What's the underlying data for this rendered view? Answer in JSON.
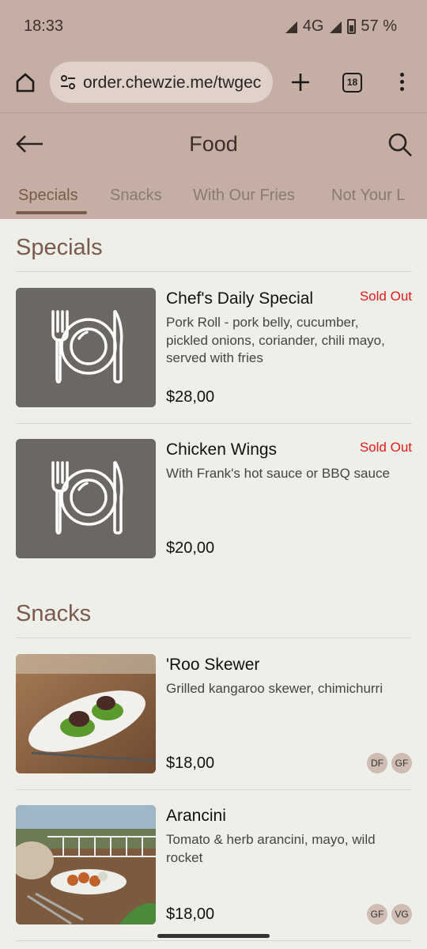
{
  "status": {
    "time": "18:33",
    "network": "4G",
    "battery": "57 %"
  },
  "browser": {
    "url": "order.chewzie.me/twgec",
    "tab_count": "18"
  },
  "appbar": {
    "title": "Food"
  },
  "categories": [
    {
      "label": "Specials"
    },
    {
      "label": "Snacks"
    },
    {
      "label": "With Our Fries"
    },
    {
      "label": "Not Your L"
    }
  ],
  "sections": [
    {
      "title": "Specials",
      "items": [
        {
          "name": "Chef's Daily Special",
          "status": "Sold Out",
          "description": "Pork Roll - pork belly, cucumber, pickled onions, coriander, chili mayo, served with fries",
          "price": "$28,00",
          "image": "placeholder-plate-icon"
        },
        {
          "name": "Chicken Wings",
          "status": "Sold Out",
          "description": "With Frank's hot sauce or BBQ sauce",
          "price": "$20,00",
          "image": "placeholder-plate-icon"
        }
      ]
    },
    {
      "title": "Snacks",
      "items": [
        {
          "name": "'Roo Skewer",
          "description": "Grilled kangaroo skewer, chimichurri",
          "price": "$18,00",
          "badges": [
            "DF",
            "GF"
          ],
          "image": "roo-skewer-photo"
        },
        {
          "name": "Arancini",
          "description": "Tomato & herb arancini, mayo, wild rocket",
          "price": "$18,00",
          "badges": [
            "GF",
            "VG"
          ],
          "image": "arancini-photo"
        }
      ]
    }
  ],
  "colors": {
    "header_bg": "#c5aea3",
    "accent": "#7a5a4c",
    "sold_out": "#e51a1a",
    "page_bg": "#efefea"
  }
}
